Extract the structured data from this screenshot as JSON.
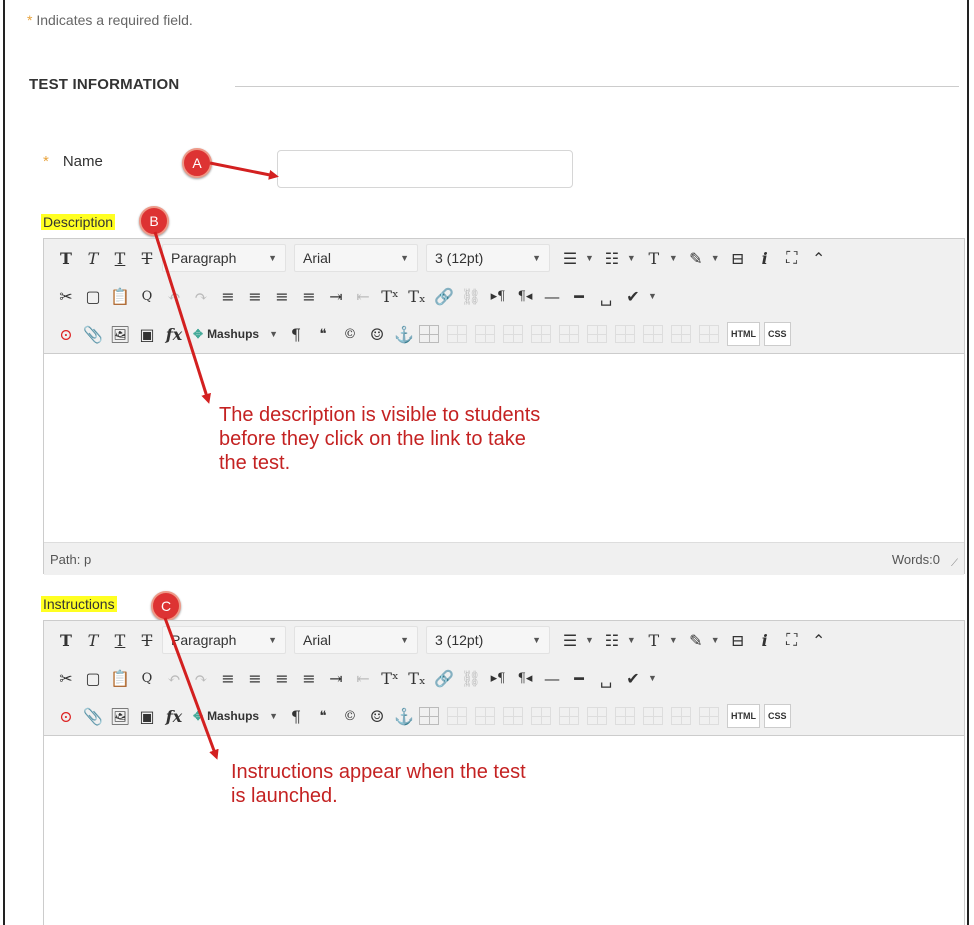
{
  "required_note": {
    "star": "*",
    "text": "Indicates a required field."
  },
  "section": {
    "title": "TEST INFORMATION"
  },
  "name_field": {
    "star": "*",
    "label": "Name",
    "value": ""
  },
  "callouts": {
    "a": "A",
    "b": "B",
    "c": "C"
  },
  "description": {
    "label": "Description",
    "annotation_lines": [
      "The description is visible to students",
      "before they click on the link to take",
      "the test."
    ],
    "path": "Path: p",
    "words": "Words:0"
  },
  "instructions": {
    "label": "Instructions",
    "annotation_lines": [
      "Instructions appear when the test",
      "is launched."
    ]
  },
  "toolbar": {
    "format": "Paragraph",
    "font": "Arial",
    "size": "3 (12pt)",
    "mashups": "Mashups",
    "html": "HTML",
    "css": "CSS",
    "fx": "fx"
  },
  "colors": {
    "required_star": "#e8a33d",
    "callout": "#dd3333",
    "annotation": "#c42222",
    "label_highlight": "#ffff22"
  }
}
